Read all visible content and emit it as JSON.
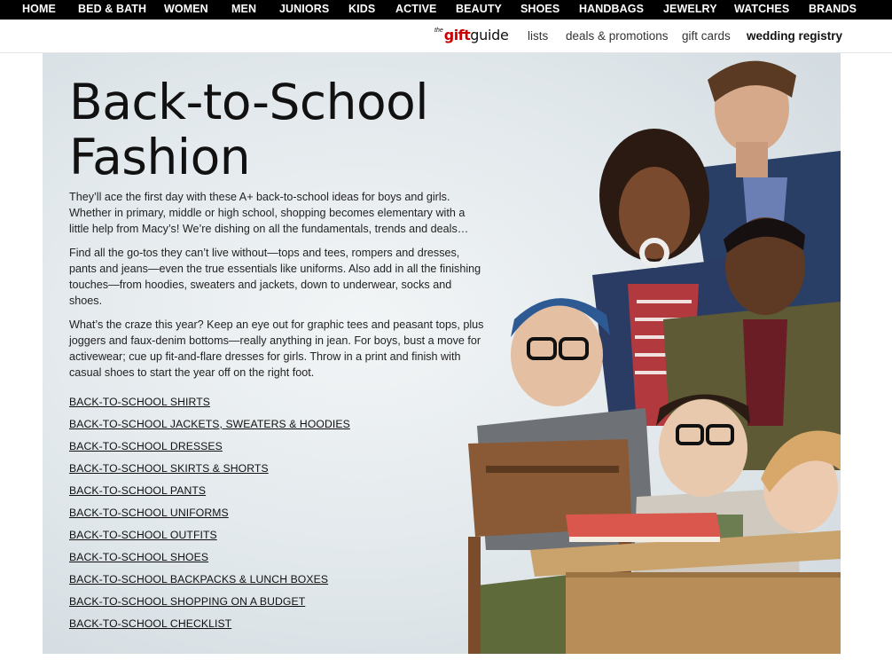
{
  "top_nav": [
    "HOME",
    "BED & BATH",
    "WOMEN",
    "MEN",
    "JUNIORS",
    "KIDS",
    "ACTIVE",
    "BEAUTY",
    "SHOES",
    "HANDBAGS",
    "JEWELRY",
    "WATCHES",
    "BRANDS"
  ],
  "sub_nav": {
    "gift_guide": {
      "the": "the",
      "gift": "gift",
      "guide": "guide"
    },
    "lists": "lists",
    "deals": "deals & promotions",
    "gift_cards": "gift cards",
    "registry": "wedding registry"
  },
  "hero": {
    "title_line1": "Back-to-School",
    "title_line2": "Fashion",
    "paragraphs": [
      "They’ll ace the first day with these A+ back-to-school ideas for boys and girls. Whether in primary, middle or high school, shopping becomes elementary with a little help from Macy’s! We’re dishing on all the fundamentals, trends and deals…",
      "Find all the go-tos they can’t live without—tops and tees, rompers and dresses, pants and jeans—even the true essentials like uniforms. Also add in all the finishing touches—from hoodies, sweaters and jackets, down to underwear, socks and shoes.",
      "What’s the craze this year? Keep an eye out for graphic tees and peasant tops, plus joggers and faux-denim bottoms—really anything in jean. For boys, bust a move for activewear; cue up fit-and-flare dresses for girls. Throw in a print and finish with casual shoes to start the year off on the right foot."
    ],
    "links": [
      "BACK-TO-SCHOOL SHIRTS",
      "BACK-TO-SCHOOL JACKETS, SWEATERS & HOODIES",
      "BACK-TO-SCHOOL DRESSES",
      "BACK-TO-SCHOOL SKIRTS & SHORTS",
      "BACK-TO-SCHOOL PANTS",
      "BACK-TO-SCHOOL UNIFORMS",
      "BACK-TO-SCHOOL OUTFITS",
      "BACK-TO-SCHOOL SHOES",
      "BACK-TO-SCHOOL BACKPACKS & LUNCH BOXES",
      "BACK-TO-SCHOOL SHOPPING ON A BUDGET",
      "BACK-TO-SCHOOL CHECKLIST"
    ]
  },
  "colors": {
    "nav_bg": "#000000",
    "gift_red": "#cc0000",
    "hero_bg": "#dfe6ea"
  }
}
